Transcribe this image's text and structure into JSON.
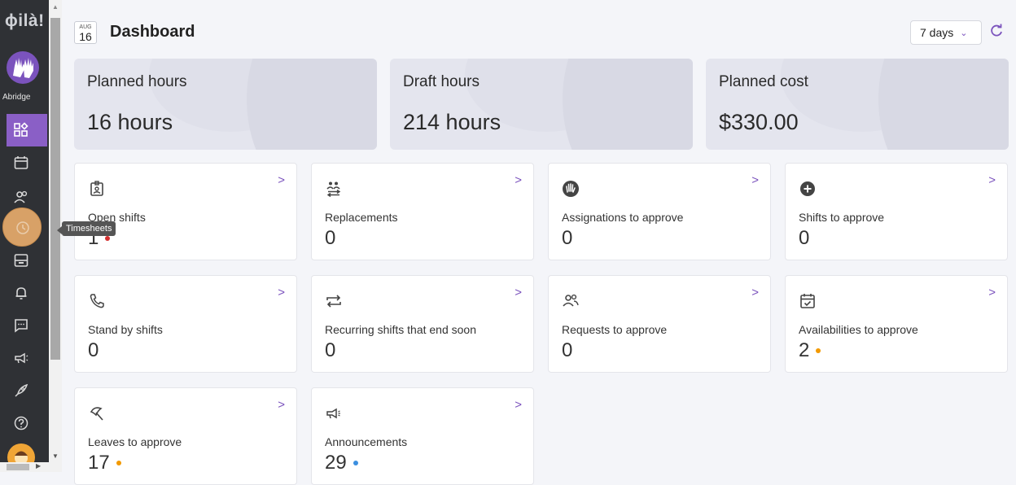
{
  "sidebar": {
    "logo": "ɸilà!",
    "org_name": "Abridge",
    "tooltip": "Timesheets"
  },
  "header": {
    "date_month": "AUG",
    "date_day": "16",
    "title": "Dashboard",
    "range_value": "7 days"
  },
  "summary": [
    {
      "label": "Planned hours",
      "value": "16 hours"
    },
    {
      "label": "Draft hours",
      "value": "214 hours"
    },
    {
      "label": "Planned cost",
      "value": "$330.00"
    }
  ],
  "cards": [
    {
      "label": "Open shifts",
      "count": "1",
      "icon": "badge-icon",
      "dot_color": "#d32f2f"
    },
    {
      "label": "Replacements",
      "count": "0",
      "icon": "people-swap-icon",
      "dot_color": ""
    },
    {
      "label": "Assignations to approve",
      "count": "0",
      "icon": "hand-icon",
      "dot_color": ""
    },
    {
      "label": "Shifts to approve",
      "count": "0",
      "icon": "plus-circle-icon",
      "dot_color": ""
    },
    {
      "label": "Stand by shifts",
      "count": "0",
      "icon": "phone-icon",
      "dot_color": ""
    },
    {
      "label": "Recurring shifts that end soon",
      "count": "0",
      "icon": "repeat-icon",
      "dot_color": ""
    },
    {
      "label": "Requests to approve",
      "count": "0",
      "icon": "people-icon",
      "dot_color": ""
    },
    {
      "label": "Availabilities to approve",
      "count": "2",
      "icon": "calendar-check-icon",
      "dot_color": "#f29900"
    },
    {
      "label": "Leaves to approve",
      "count": "17",
      "icon": "umbrella-icon",
      "dot_color": "#f29900"
    },
    {
      "label": "Announcements",
      "count": "29",
      "icon": "megaphone-icon",
      "dot_color": "#3b8fe0"
    }
  ],
  "colors": {
    "accent": "#7b53bd",
    "sidebar_bg": "#2f3135",
    "active_nav": "#8a5fc6"
  }
}
